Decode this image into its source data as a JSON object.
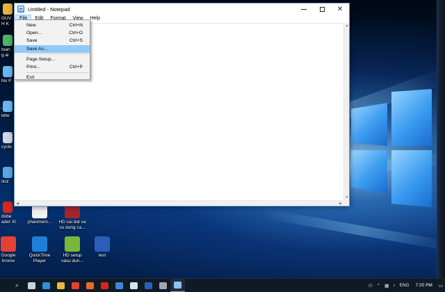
{
  "notepad": {
    "title": "Untitled - Notepad",
    "menus": [
      "File",
      "Edit",
      "Format",
      "View",
      "Help"
    ],
    "active_menu": "File"
  },
  "file_menu": {
    "items": [
      {
        "label": "New",
        "shortcut": "Ctrl+N"
      },
      {
        "label": "Open...",
        "shortcut": "Ctrl+O"
      },
      {
        "label": "Save",
        "shortcut": "Ctrl+S"
      },
      {
        "label": "Save As...",
        "shortcut": ""
      },
      {
        "label": "Page Setup...",
        "shortcut": ""
      },
      {
        "label": "Print...",
        "shortcut": "Ctrl+P"
      },
      {
        "label": "Exit",
        "shortcut": ""
      }
    ],
    "highlighted": "Save As..."
  },
  "desktop_icons": [
    {
      "label": "GUV\nH K",
      "icon": "folder-icon",
      "color": "#e7b43c"
    },
    {
      "label": "toan\ng ai",
      "icon": "document-icon",
      "color": "#4fb36b"
    },
    {
      "label": "his P",
      "icon": "computer-icon",
      "color": "#6cb6f0"
    },
    {
      "label": "letw",
      "icon": "network-icon",
      "color": "#6cb6f0"
    },
    {
      "label": "cycle",
      "icon": "recycle-bin-icon",
      "color": "#cfd8e3"
    },
    {
      "label": "itrol",
      "icon": "control-panel-icon",
      "color": "#5aa8e0"
    },
    {
      "label": "dobe\nader XI",
      "icon": "adobe-reader-icon",
      "color": "#d8261c"
    },
    {
      "label": "phanmem...",
      "icon": "blank-file-icon",
      "color": "#f2f2f2"
    },
    {
      "label": "HD cai dat va\nsu dung ca...",
      "icon": "winrar-icon",
      "color": "#a3262a"
    },
    {
      "label": "Google\nhrome",
      "icon": "chrome-icon",
      "color": "#e34133"
    },
    {
      "label": "QuickTime\nPlayer",
      "icon": "quicktime-icon",
      "color": "#1f7fd8"
    },
    {
      "label": "HD setup\nvasu dun...",
      "icon": "video-file-icon",
      "color": "#79b83a"
    },
    {
      "label": "test",
      "icon": "word-document-icon",
      "color": "#2b5eb8"
    }
  ],
  "taskbar": {
    "apps": [
      {
        "name": "search-icon",
        "glyph": "⌕",
        "color": ""
      },
      {
        "name": "task-view-icon",
        "glyph": "",
        "color": "#c8d4e0"
      },
      {
        "name": "edge-icon",
        "glyph": "",
        "color": "#2f8fe0"
      },
      {
        "name": "file-explorer-icon",
        "glyph": "",
        "color": "#e8b93a"
      },
      {
        "name": "chrome-icon",
        "glyph": "",
        "color": "#e34133"
      },
      {
        "name": "firefox-icon",
        "glyph": "",
        "color": "#e86c2a"
      },
      {
        "name": "opera-icon",
        "glyph": "",
        "color": "#d8261c"
      },
      {
        "name": "store-icon",
        "glyph": "",
        "color": "#3a86d8"
      },
      {
        "name": "mail-icon",
        "glyph": "",
        "color": "#d9e2ec"
      },
      {
        "name": "word-icon",
        "glyph": "",
        "color": "#2b5eb8"
      },
      {
        "name": "snipping-tool-icon",
        "glyph": "",
        "color": "#9aa7b4"
      },
      {
        "name": "notepad-icon",
        "glyph": "",
        "color": "#8fc2f0"
      }
    ],
    "running": "notepad-icon",
    "language": "ENG",
    "time": "7:20 PM",
    "date": ""
  }
}
